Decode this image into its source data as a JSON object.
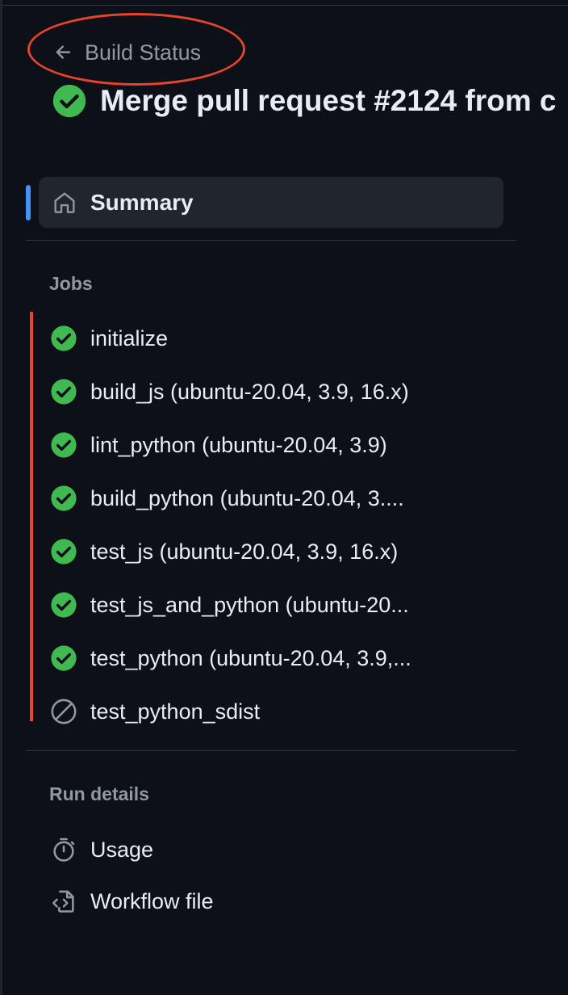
{
  "header": {
    "back_label": "Build Status",
    "run_title": "Merge pull request #2124 from c"
  },
  "nav": {
    "summary_label": "Summary"
  },
  "jobs": {
    "heading": "Jobs",
    "items": [
      {
        "label": "initialize",
        "status": "success"
      },
      {
        "label": "build_js (ubuntu-20.04, 3.9, 16.x)",
        "status": "success"
      },
      {
        "label": "lint_python (ubuntu-20.04, 3.9)",
        "status": "success"
      },
      {
        "label": "build_python (ubuntu-20.04, 3....",
        "status": "success"
      },
      {
        "label": "test_js (ubuntu-20.04, 3.9, 16.x)",
        "status": "success"
      },
      {
        "label": "test_js_and_python (ubuntu-20...",
        "status": "success"
      },
      {
        "label": "test_python (ubuntu-20.04, 3.9,...",
        "status": "success"
      },
      {
        "label": "test_python_sdist",
        "status": "skipped"
      }
    ]
  },
  "run_details": {
    "heading": "Run details",
    "items": [
      {
        "label": "Usage",
        "icon": "stopwatch-icon"
      },
      {
        "label": "Workflow file",
        "icon": "file-code-icon"
      }
    ]
  },
  "colors": {
    "background": "#0d1117",
    "success": "#3fb950",
    "muted": "#9198a1",
    "accent": "#4493f8",
    "annotation": "#e8432d"
  }
}
